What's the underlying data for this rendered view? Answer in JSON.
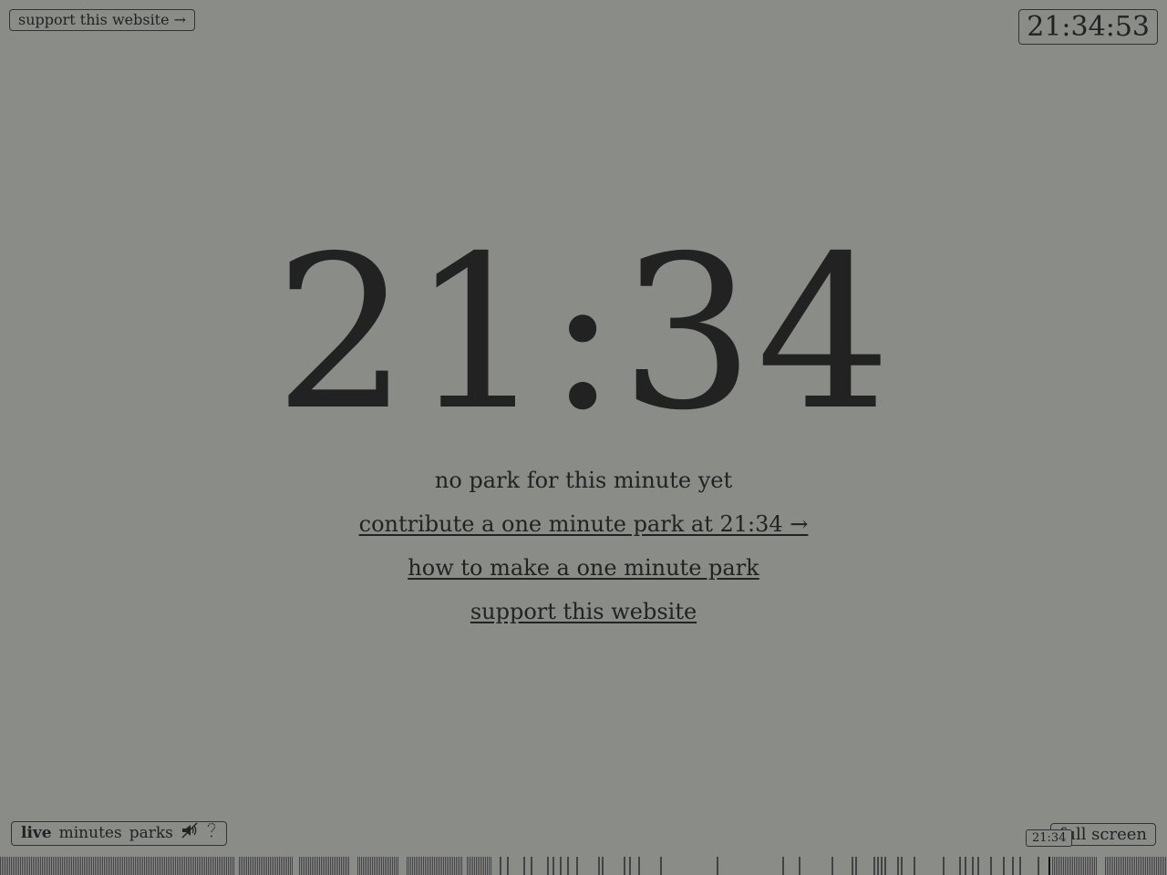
{
  "header": {
    "support_label": "support this website →",
    "clock": "21:34:53"
  },
  "main": {
    "big_time": "21:34",
    "no_park_text": "no park for this minute yet",
    "contribute_link": "contribute a one minute park at 21:34 →",
    "howto_link": "how to make a one minute park",
    "support_link": "support this website"
  },
  "footer": {
    "modes": [
      {
        "label": "live",
        "active": true
      },
      {
        "label": "minutes",
        "active": false
      },
      {
        "label": "parks",
        "active": false
      }
    ],
    "sound_icon": "sound-muted-icon",
    "help_icon": "question-icon",
    "fullscreen_label": "full screen",
    "timeline_current": "21:34"
  },
  "colors": {
    "background": "#8a8c88",
    "ink": "#222222"
  }
}
